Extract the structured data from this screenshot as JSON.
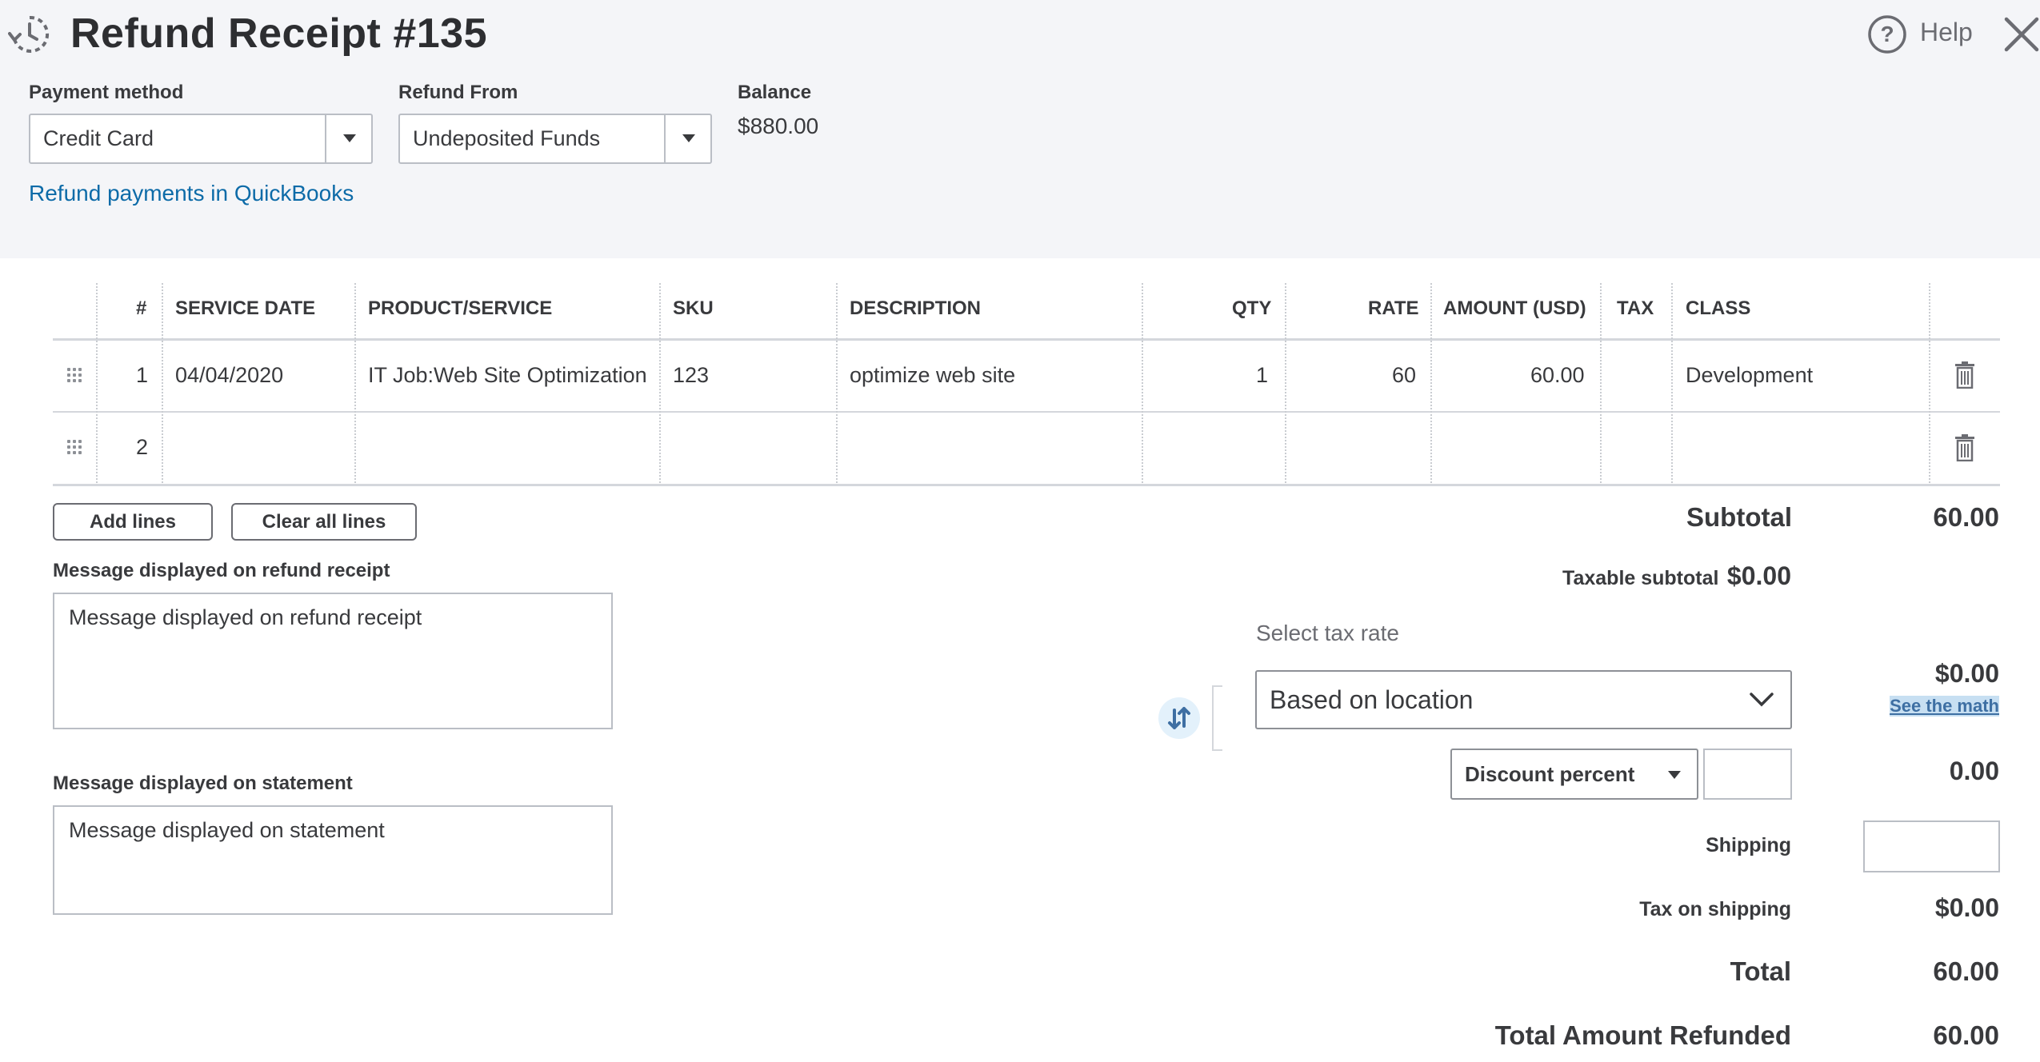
{
  "header": {
    "title": "Refund Receipt #135",
    "help_label": "Help",
    "payment_method": {
      "label": "Payment method",
      "value": "Credit Card"
    },
    "refund_from": {
      "label": "Refund From",
      "value": "Undeposited Funds"
    },
    "balance": {
      "label": "Balance",
      "value": "$880.00"
    },
    "refund_link": "Refund payments in QuickBooks"
  },
  "table": {
    "columns": [
      "#",
      "SERVICE DATE",
      "PRODUCT/SERVICE",
      "SKU",
      "DESCRIPTION",
      "QTY",
      "RATE",
      "AMOUNT (USD)",
      "TAX",
      "CLASS"
    ],
    "rows": [
      {
        "num": "1",
        "service_date": "04/04/2020",
        "product": "IT Job:Web Site Optimization",
        "sku": "123",
        "description": "optimize web site",
        "qty": "1",
        "rate": "60",
        "amount": "60.00",
        "tax": "",
        "class": "Development"
      },
      {
        "num": "2",
        "service_date": "",
        "product": "",
        "sku": "",
        "description": "",
        "qty": "",
        "rate": "",
        "amount": "",
        "tax": "",
        "class": ""
      }
    ]
  },
  "buttons": {
    "add_lines": "Add lines",
    "clear_all_lines": "Clear all lines"
  },
  "messages": {
    "receipt_label": "Message displayed on refund receipt",
    "receipt_placeholder": "Message displayed on refund receipt",
    "statement_label": "Message displayed on statement",
    "statement_placeholder": "Message displayed on statement"
  },
  "totals": {
    "subtotal_label": "Subtotal",
    "subtotal_value": "60.00",
    "taxable_subtotal_label": "Taxable subtotal",
    "taxable_subtotal_value": "$0.00",
    "select_tax_rate_label": "Select tax rate",
    "tax_rate_value": "Based on location",
    "tax_value": "$0.00",
    "see_math_link": "See the math",
    "discount_type": "Discount percent",
    "discount_value": "0.00",
    "shipping_label": "Shipping",
    "tax_on_shipping_label": "Tax on shipping",
    "tax_on_shipping_value": "$0.00",
    "total_label": "Total",
    "total_value": "60.00",
    "total_refunded_label": "Total Amount Refunded",
    "total_refunded_value": "60.00"
  },
  "colors": {
    "header_bg": "#f4f5f8",
    "link": "#0d6ba8",
    "text": "#393a3d"
  }
}
